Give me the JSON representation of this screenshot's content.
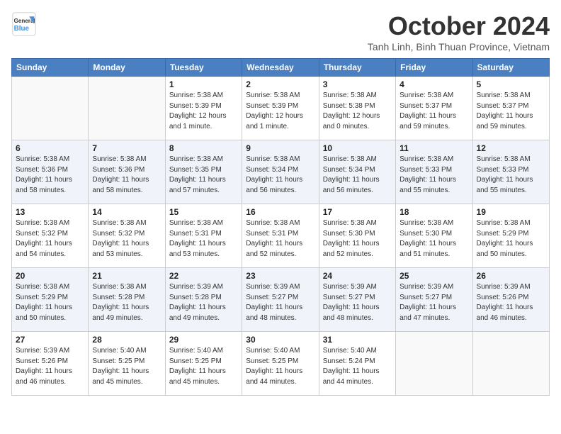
{
  "header": {
    "logo_general": "General",
    "logo_blue": "Blue",
    "month_title": "October 2024",
    "location": "Tanh Linh, Binh Thuan Province, Vietnam"
  },
  "days_of_week": [
    "Sunday",
    "Monday",
    "Tuesday",
    "Wednesday",
    "Thursday",
    "Friday",
    "Saturday"
  ],
  "weeks": [
    [
      {
        "day": "",
        "info": ""
      },
      {
        "day": "",
        "info": ""
      },
      {
        "day": "1",
        "info": "Sunrise: 5:38 AM\nSunset: 5:39 PM\nDaylight: 12 hours\nand 1 minute."
      },
      {
        "day": "2",
        "info": "Sunrise: 5:38 AM\nSunset: 5:39 PM\nDaylight: 12 hours\nand 1 minute."
      },
      {
        "day": "3",
        "info": "Sunrise: 5:38 AM\nSunset: 5:38 PM\nDaylight: 12 hours\nand 0 minutes."
      },
      {
        "day": "4",
        "info": "Sunrise: 5:38 AM\nSunset: 5:37 PM\nDaylight: 11 hours\nand 59 minutes."
      },
      {
        "day": "5",
        "info": "Sunrise: 5:38 AM\nSunset: 5:37 PM\nDaylight: 11 hours\nand 59 minutes."
      }
    ],
    [
      {
        "day": "6",
        "info": "Sunrise: 5:38 AM\nSunset: 5:36 PM\nDaylight: 11 hours\nand 58 minutes."
      },
      {
        "day": "7",
        "info": "Sunrise: 5:38 AM\nSunset: 5:36 PM\nDaylight: 11 hours\nand 58 minutes."
      },
      {
        "day": "8",
        "info": "Sunrise: 5:38 AM\nSunset: 5:35 PM\nDaylight: 11 hours\nand 57 minutes."
      },
      {
        "day": "9",
        "info": "Sunrise: 5:38 AM\nSunset: 5:34 PM\nDaylight: 11 hours\nand 56 minutes."
      },
      {
        "day": "10",
        "info": "Sunrise: 5:38 AM\nSunset: 5:34 PM\nDaylight: 11 hours\nand 56 minutes."
      },
      {
        "day": "11",
        "info": "Sunrise: 5:38 AM\nSunset: 5:33 PM\nDaylight: 11 hours\nand 55 minutes."
      },
      {
        "day": "12",
        "info": "Sunrise: 5:38 AM\nSunset: 5:33 PM\nDaylight: 11 hours\nand 55 minutes."
      }
    ],
    [
      {
        "day": "13",
        "info": "Sunrise: 5:38 AM\nSunset: 5:32 PM\nDaylight: 11 hours\nand 54 minutes."
      },
      {
        "day": "14",
        "info": "Sunrise: 5:38 AM\nSunset: 5:32 PM\nDaylight: 11 hours\nand 53 minutes."
      },
      {
        "day": "15",
        "info": "Sunrise: 5:38 AM\nSunset: 5:31 PM\nDaylight: 11 hours\nand 53 minutes."
      },
      {
        "day": "16",
        "info": "Sunrise: 5:38 AM\nSunset: 5:31 PM\nDaylight: 11 hours\nand 52 minutes."
      },
      {
        "day": "17",
        "info": "Sunrise: 5:38 AM\nSunset: 5:30 PM\nDaylight: 11 hours\nand 52 minutes."
      },
      {
        "day": "18",
        "info": "Sunrise: 5:38 AM\nSunset: 5:30 PM\nDaylight: 11 hours\nand 51 minutes."
      },
      {
        "day": "19",
        "info": "Sunrise: 5:38 AM\nSunset: 5:29 PM\nDaylight: 11 hours\nand 50 minutes."
      }
    ],
    [
      {
        "day": "20",
        "info": "Sunrise: 5:38 AM\nSunset: 5:29 PM\nDaylight: 11 hours\nand 50 minutes."
      },
      {
        "day": "21",
        "info": "Sunrise: 5:38 AM\nSunset: 5:28 PM\nDaylight: 11 hours\nand 49 minutes."
      },
      {
        "day": "22",
        "info": "Sunrise: 5:39 AM\nSunset: 5:28 PM\nDaylight: 11 hours\nand 49 minutes."
      },
      {
        "day": "23",
        "info": "Sunrise: 5:39 AM\nSunset: 5:27 PM\nDaylight: 11 hours\nand 48 minutes."
      },
      {
        "day": "24",
        "info": "Sunrise: 5:39 AM\nSunset: 5:27 PM\nDaylight: 11 hours\nand 48 minutes."
      },
      {
        "day": "25",
        "info": "Sunrise: 5:39 AM\nSunset: 5:27 PM\nDaylight: 11 hours\nand 47 minutes."
      },
      {
        "day": "26",
        "info": "Sunrise: 5:39 AM\nSunset: 5:26 PM\nDaylight: 11 hours\nand 46 minutes."
      }
    ],
    [
      {
        "day": "27",
        "info": "Sunrise: 5:39 AM\nSunset: 5:26 PM\nDaylight: 11 hours\nand 46 minutes."
      },
      {
        "day": "28",
        "info": "Sunrise: 5:40 AM\nSunset: 5:25 PM\nDaylight: 11 hours\nand 45 minutes."
      },
      {
        "day": "29",
        "info": "Sunrise: 5:40 AM\nSunset: 5:25 PM\nDaylight: 11 hours\nand 45 minutes."
      },
      {
        "day": "30",
        "info": "Sunrise: 5:40 AM\nSunset: 5:25 PM\nDaylight: 11 hours\nand 44 minutes."
      },
      {
        "day": "31",
        "info": "Sunrise: 5:40 AM\nSunset: 5:24 PM\nDaylight: 11 hours\nand 44 minutes."
      },
      {
        "day": "",
        "info": ""
      },
      {
        "day": "",
        "info": ""
      }
    ]
  ]
}
